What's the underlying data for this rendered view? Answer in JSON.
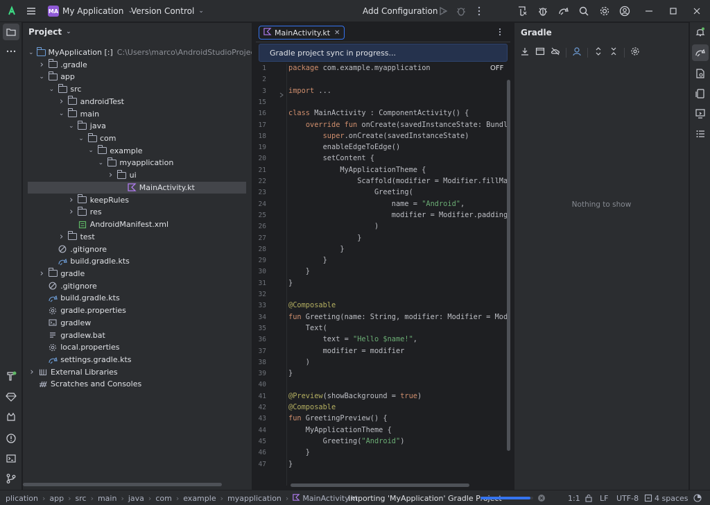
{
  "titlebar": {
    "project_badge": "MA",
    "project_name": "My Application",
    "vcs_label": "Version Control",
    "run_config": "Add Configuration"
  },
  "project_panel": {
    "title": "Project",
    "tree": [
      {
        "label": "MyApplication [:]",
        "path": "C:\\Users\\marco\\AndroidStudioProjects\\MyApp",
        "icon": "module-folder-icon",
        "expanded": true
      },
      {
        "label": ".gradle",
        "icon": "folder-icon",
        "expanded": false
      },
      {
        "label": "app",
        "icon": "folder-icon",
        "expanded": true
      },
      {
        "label": "src",
        "icon": "folder-icon",
        "expanded": true
      },
      {
        "label": "androidTest",
        "icon": "folder-icon",
        "expanded": false
      },
      {
        "label": "main",
        "icon": "folder-icon",
        "expanded": true
      },
      {
        "label": "java",
        "icon": "folder-icon",
        "expanded": true
      },
      {
        "label": "com",
        "icon": "folder-icon",
        "expanded": true
      },
      {
        "label": "example",
        "icon": "folder-icon",
        "expanded": true
      },
      {
        "label": "myapplication",
        "icon": "folder-icon",
        "expanded": true
      },
      {
        "label": "ui",
        "icon": "folder-icon",
        "expanded": false
      },
      {
        "label": "MainActivity.kt",
        "icon": "kotlin-file-icon",
        "selected": true
      },
      {
        "label": "keepRules",
        "icon": "folder-icon",
        "expanded": false
      },
      {
        "label": "res",
        "icon": "folder-icon",
        "expanded": false
      },
      {
        "label": "AndroidManifest.xml",
        "icon": "manifest-icon"
      },
      {
        "label": "test",
        "icon": "folder-icon",
        "expanded": false
      },
      {
        "label": ".gitignore",
        "icon": "gitignore-icon"
      },
      {
        "label": "build.gradle.kts",
        "icon": "gradle-file-icon"
      },
      {
        "label": "gradle",
        "icon": "folder-icon",
        "expanded": false
      },
      {
        "label": ".gitignore",
        "icon": "gitignore-icon"
      },
      {
        "label": "build.gradle.kts",
        "icon": "gradle-file-icon"
      },
      {
        "label": "gradle.properties",
        "icon": "settings-file-icon"
      },
      {
        "label": "gradlew",
        "icon": "terminal-file-icon"
      },
      {
        "label": "gradlew.bat",
        "icon": "text-file-icon"
      },
      {
        "label": "local.properties",
        "icon": "settings-file-icon"
      },
      {
        "label": "settings.gradle.kts",
        "icon": "gradle-file-icon"
      },
      {
        "label": "External Libraries",
        "icon": "library-icon",
        "expanded": false
      },
      {
        "label": "Scratches and Consoles",
        "icon": "scratches-icon"
      }
    ]
  },
  "editor": {
    "tab_label": "MainActivity.kt",
    "sync_banner": "Gradle project sync in progress...",
    "off_badge": "OFF",
    "lines": [
      {
        "n": "1",
        "text": "package com.example.myapplication"
      },
      {
        "n": "2",
        "text": ""
      },
      {
        "n": "3",
        "text": "import ..."
      },
      {
        "n": "15",
        "text": ""
      },
      {
        "n": "16",
        "text": "class MainActivity : ComponentActivity() {"
      },
      {
        "n": "17",
        "text": "    override fun onCreate(savedInstanceState: Bundle?) {"
      },
      {
        "n": "18",
        "text": "        super.onCreate(savedInstanceState)"
      },
      {
        "n": "19",
        "text": "        enableEdgeToEdge()"
      },
      {
        "n": "20",
        "text": "        setContent {"
      },
      {
        "n": "21",
        "text": "            MyApplicationTheme {"
      },
      {
        "n": "22",
        "text": "                Scaffold(modifier = Modifier.fillMaxSize()) {"
      },
      {
        "n": "23",
        "text": "                    Greeting("
      },
      {
        "n": "24",
        "text": "                        name = \"Android\","
      },
      {
        "n": "25",
        "text": "                        modifier = Modifier.padding(innerPadding)"
      },
      {
        "n": "26",
        "text": "                    )"
      },
      {
        "n": "27",
        "text": "                }"
      },
      {
        "n": "28",
        "text": "            }"
      },
      {
        "n": "29",
        "text": "        }"
      },
      {
        "n": "30",
        "text": "    }"
      },
      {
        "n": "31",
        "text": "}"
      },
      {
        "n": "32",
        "text": ""
      },
      {
        "n": "33",
        "text": "@Composable"
      },
      {
        "n": "34",
        "text": "fun Greeting(name: String, modifier: Modifier = Modifier) {"
      },
      {
        "n": "35",
        "text": "    Text("
      },
      {
        "n": "36",
        "text": "        text = \"Hello $name!\","
      },
      {
        "n": "37",
        "text": "        modifier = modifier"
      },
      {
        "n": "38",
        "text": "    )"
      },
      {
        "n": "39",
        "text": "}"
      },
      {
        "n": "40",
        "text": ""
      },
      {
        "n": "41",
        "text": "@Preview(showBackground = true)"
      },
      {
        "n": "42",
        "text": "@Composable"
      },
      {
        "n": "43",
        "text": "fun GreetingPreview() {"
      },
      {
        "n": "44",
        "text": "    MyApplicationTheme {"
      },
      {
        "n": "45",
        "text": "        Greeting(\"Android\")"
      },
      {
        "n": "46",
        "text": "    }"
      },
      {
        "n": "47",
        "text": "}"
      }
    ]
  },
  "gradle_panel": {
    "title": "Gradle",
    "empty_text": "Nothing to show"
  },
  "statusbar": {
    "breadcrumbs": [
      "plication",
      "app",
      "src",
      "main",
      "java",
      "com",
      "example",
      "myapplication",
      "MainActivity.kt"
    ],
    "task": "Importing 'MyApplication' Gradle Project",
    "progress": 0.95,
    "position": "1:1",
    "line_sep": "LF",
    "encoding": "UTF-8",
    "indent": "4 spaces"
  },
  "colors": {
    "accent": "#3574f0",
    "kotlin": "#b07cf0",
    "keyword": "#cf8e6d",
    "string": "#6aab73",
    "annotation": "#b3ae60"
  }
}
